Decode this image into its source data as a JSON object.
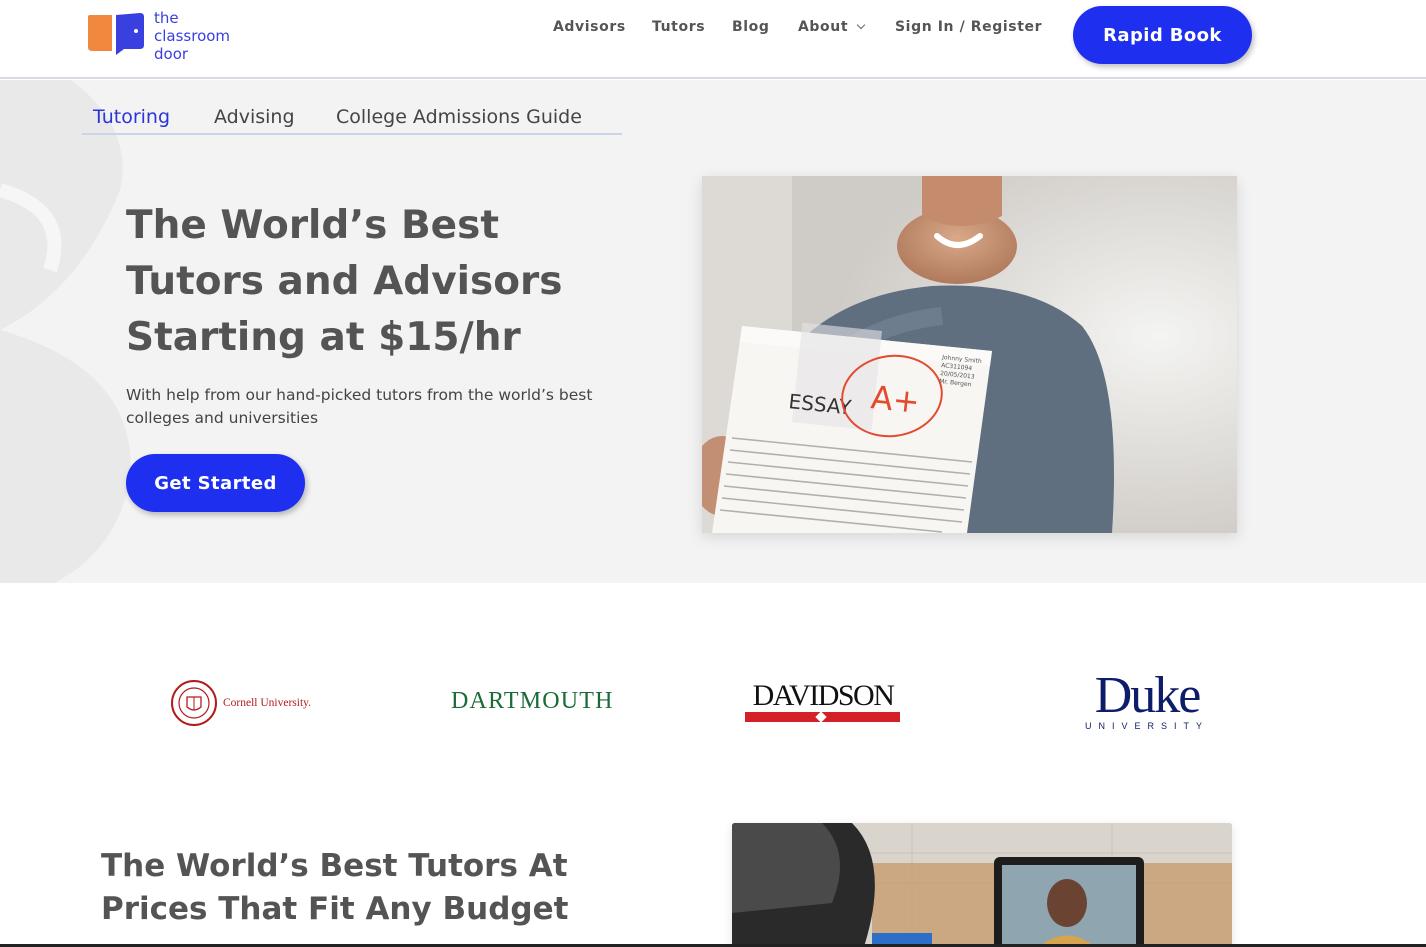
{
  "brand": {
    "line1": "the",
    "line2": "classroom",
    "line3": "door",
    "accent": "#1f2ff0",
    "logo_orange": "#f0883e",
    "logo_blue": "#3a3fe0"
  },
  "nav": {
    "items": [
      "Advisors",
      "Tutors",
      "Blog",
      "About",
      "Sign In / Register"
    ],
    "cta": "Rapid Book"
  },
  "subnav": {
    "tabs": [
      "Tutoring",
      "Advising",
      "College Admissions Guide"
    ],
    "active": "Tutoring"
  },
  "hero": {
    "title": "The World’s Best Tutors and Advisors Starting at $15/hr",
    "subtitle": "With help from our hand-picked tutors from the world’s best colleges and universities",
    "cta": "Get Started",
    "photo": {
      "paper_title": "ESSAY",
      "grade": "A+",
      "name_line1": "Johnny Smith",
      "name_line2": "AC311094",
      "name_line3": "20/05/2013",
      "name_line4": "Mr. Bergen"
    }
  },
  "universities": {
    "cornell": "Cornell University.",
    "dartmouth": "DARTMOUTH",
    "davidson": "DAVIDSON",
    "duke": "Duke",
    "duke_sub": "UNIVERSITY"
  },
  "section2": {
    "title": "The World’s Best Tutors At Prices That Fit Any Budget"
  }
}
